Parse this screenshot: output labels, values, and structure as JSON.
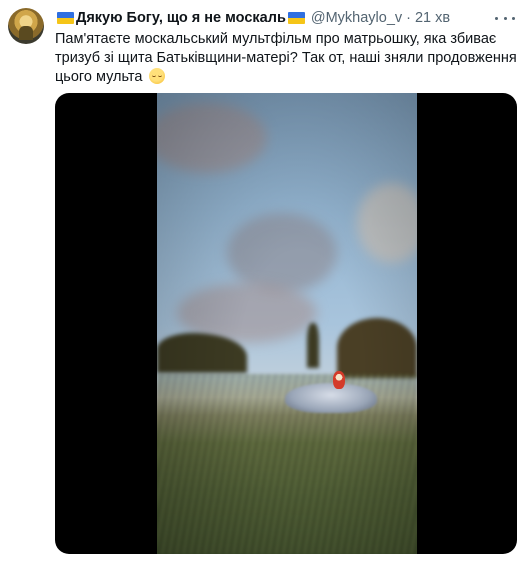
{
  "tweet": {
    "display_name": "Дякую Богу, що я не москаль",
    "handle": "@Mykhaylo_v",
    "separator": "·",
    "time": "21 хв",
    "text_lines": [
      "Пам'ятаєте москальський мультфільм про матрьошку, яка збиває",
      "тризуб зі щита Батьківщини-матері? Так от, наші зняли продовження",
      "цього мульта"
    ],
    "emoji": "relieved-face",
    "flag_colors": {
      "top": "#2f6fe0",
      "bottom": "#f5c518"
    }
  },
  "media": {
    "type": "video",
    "icon": "video-thumbnail"
  },
  "colors": {
    "text": "#0f1419",
    "secondary": "#536471",
    "background": "#ffffff"
  }
}
